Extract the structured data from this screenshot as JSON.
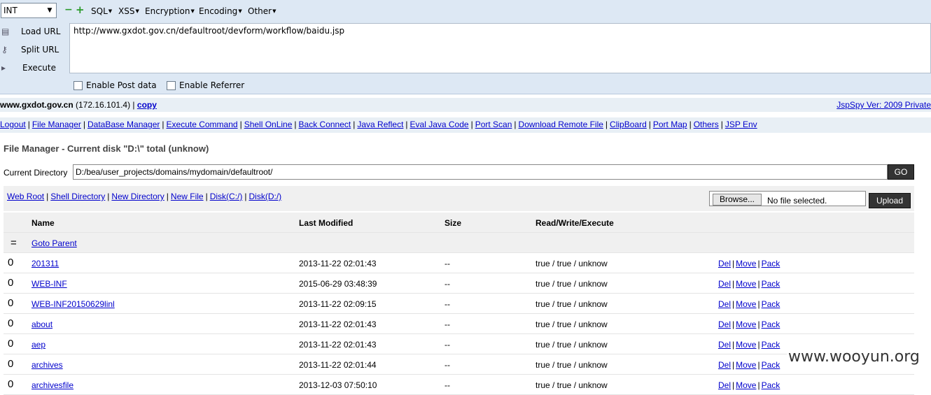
{
  "hackbar": {
    "encoding_select": "INT",
    "menus": [
      "SQL",
      "XSS",
      "Encryption",
      "Encoding",
      "Other"
    ],
    "load_url": "Load URL",
    "split_url": "Split URL",
    "execute": "Execute",
    "url": "http://www.gxdot.gov.cn/defaultroot/devform/workflow/baidu.jsp",
    "enable_post": "Enable Post data",
    "enable_referrer": "Enable Referrer"
  },
  "host": {
    "domain": "www.gxdot.gov.cn",
    "ip": "(172.16.101.4)",
    "copy": "copy",
    "version": "JspSpy Ver: 2009 Private"
  },
  "nav": [
    "Logout",
    "File Manager",
    "DataBase Manager",
    "Execute Command",
    "Shell OnLine",
    "Back Connect",
    "Java Reflect",
    "Eval Java Code",
    "Port Scan",
    "Download Remote File",
    "ClipBoard",
    "Port Map",
    "Others",
    "JSP Env"
  ],
  "file_manager": {
    "title": "File Manager - Current disk \"D:\\\" total (unknow)",
    "current_dir_label": "Current Directory",
    "current_dir": "D:/bea/user_projects/domains/mydomain/defaultroot/",
    "go": "GO",
    "tools": [
      "Web Root",
      "Shell Directory",
      "New Directory",
      "New File",
      "Disk(C:/)",
      "Disk(D:/)"
    ],
    "browse": "Browse...",
    "no_file": "No file selected.",
    "upload": "Upload"
  },
  "table": {
    "headers": [
      "Name",
      "Last Modified",
      "Size",
      "Read/Write/Execute"
    ],
    "parent_symbol": "=",
    "parent_label": "Goto Parent",
    "actions": [
      "Del",
      "Move",
      "Pack"
    ],
    "rows": [
      {
        "icon": "0",
        "name": "201311",
        "modified": "2013-11-22 02:01:43",
        "size": "--",
        "rwx": "true / true / unknow"
      },
      {
        "icon": "0",
        "name": "WEB-INF",
        "modified": "2015-06-29 03:48:39",
        "size": "--",
        "rwx": "true / true / unknow"
      },
      {
        "icon": "0",
        "name": "WEB-INF20150629linl",
        "modified": "2013-11-22 02:09:15",
        "size": "--",
        "rwx": "true / true / unknow"
      },
      {
        "icon": "0",
        "name": "about",
        "modified": "2013-11-22 02:01:43",
        "size": "--",
        "rwx": "true / true / unknow"
      },
      {
        "icon": "0",
        "name": "aep",
        "modified": "2013-11-22 02:01:43",
        "size": "--",
        "rwx": "true / true / unknow"
      },
      {
        "icon": "0",
        "name": "archives",
        "modified": "2013-11-22 02:01:44",
        "size": "--",
        "rwx": "true / true / unknow"
      },
      {
        "icon": "0",
        "name": "archivesfile",
        "modified": "2013-12-03 07:50:10",
        "size": "--",
        "rwx": "true / true / unknow"
      }
    ]
  },
  "watermark": "www.wooyun.org"
}
